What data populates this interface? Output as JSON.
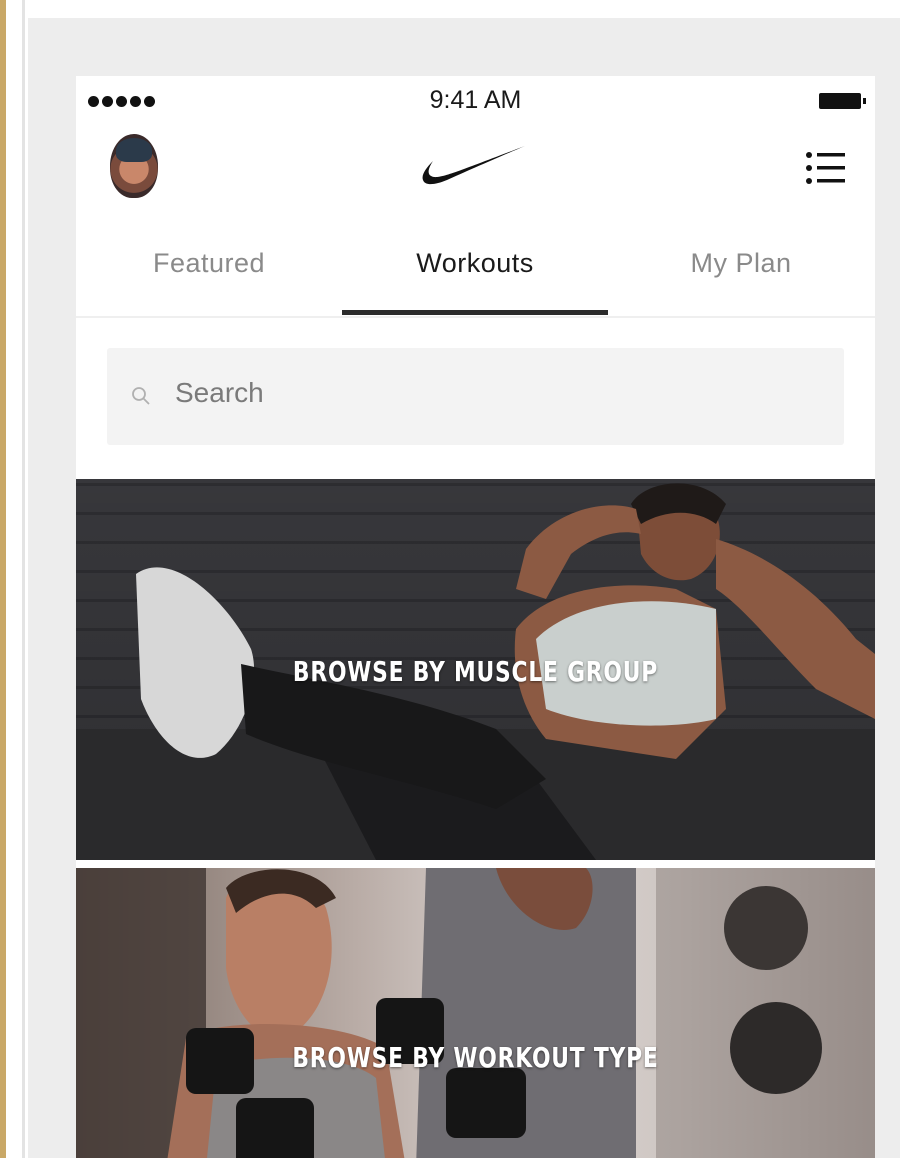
{
  "status_bar": {
    "time": "9:41 AM",
    "signal_icon": "signal-dots-icon",
    "battery_icon": "battery-icon"
  },
  "header": {
    "avatar": "profile-avatar",
    "logo_icon": "nike-swoosh-icon",
    "menu_icon": "list-menu-icon"
  },
  "tabs": [
    {
      "label": "Featured",
      "selected": false
    },
    {
      "label": "Workouts",
      "selected": true
    },
    {
      "label": "My Plan",
      "selected": false
    }
  ],
  "search": {
    "placeholder": "Search",
    "value": "",
    "icon": "search-icon"
  },
  "cards": [
    {
      "title": "BROWSE BY MUSCLE GROUP"
    },
    {
      "title": "BROWSE BY WORKOUT TYPE"
    }
  ],
  "colors": {
    "accent_rule": "#c9a867",
    "selected_tab": "#1a1a1a",
    "unselected_tab": "#8a8a8a",
    "search_bg": "#f3f3f3"
  }
}
